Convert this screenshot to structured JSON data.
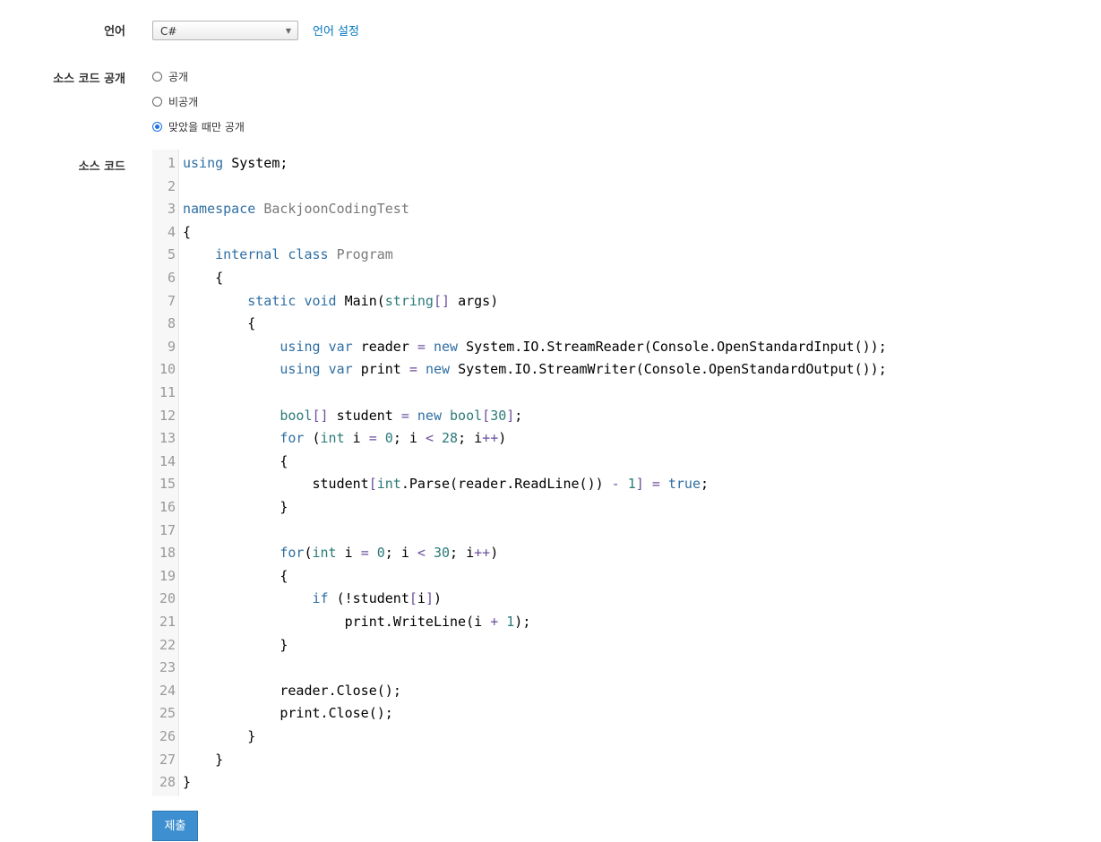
{
  "form": {
    "language": {
      "label": "언어",
      "selected": "C#",
      "setting_link": "언어 설정"
    },
    "visibility": {
      "label": "소스 코드 공개",
      "options": [
        {
          "label": "공개",
          "checked": false
        },
        {
          "label": "비공개",
          "checked": false
        },
        {
          "label": "맞았을 때만 공개",
          "checked": true
        }
      ]
    },
    "source_code": {
      "label": "소스 코드",
      "lines": [
        "using System;",
        "",
        "namespace BackjoonCodingTest",
        "{",
        "    internal class Program",
        "    {",
        "        static void Main(string[] args)",
        "        {",
        "            using var reader = new System.IO.StreamReader(Console.OpenStandardInput());",
        "            using var print = new System.IO.StreamWriter(Console.OpenStandardOutput());",
        "",
        "            bool[] student = new bool[30];",
        "            for (int i = 0; i < 28; i++)",
        "            {",
        "                student[int.Parse(reader.ReadLine()) - 1] = true;",
        "            }",
        "",
        "            for(int i = 0; i < 30; i++)",
        "            {",
        "                if (!student[i])",
        "                    print.WriteLine(i + 1);",
        "            }",
        "",
        "            reader.Close();",
        "            print.Close();",
        "        }",
        "    }",
        "}"
      ]
    },
    "submit_label": "제출"
  }
}
